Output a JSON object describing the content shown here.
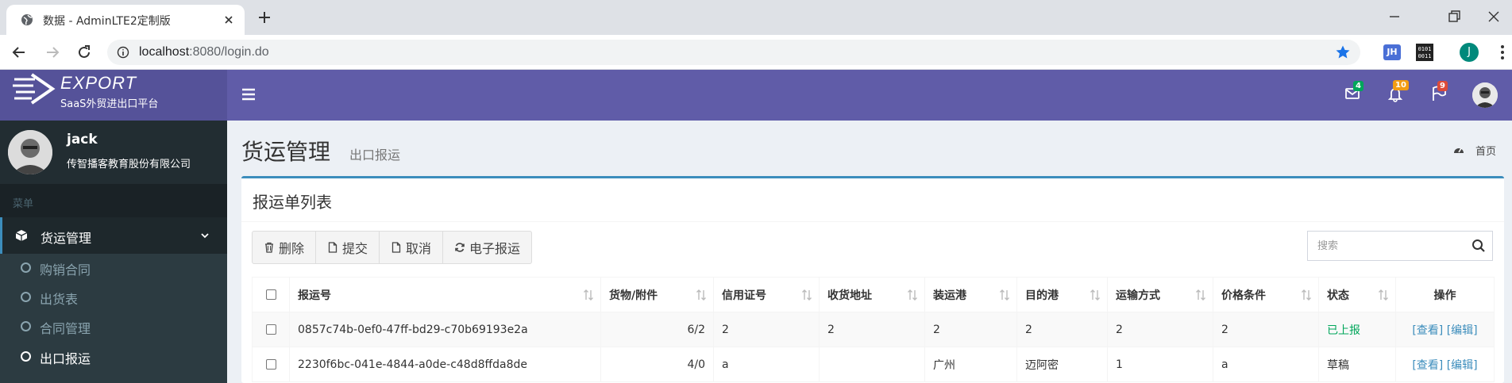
{
  "browser": {
    "tab_title": "数据 - AdminLTE2定制版",
    "url_host": "localhost",
    "url_rest": ":8080/login.do",
    "profile_initial": "J",
    "ext_jh": "JH"
  },
  "app": {
    "logo_text": "EXPORT",
    "logo_subtitle": "SaaS外贸进出口平台",
    "notifications": {
      "messages": "4",
      "alerts": "10",
      "tasks": "9"
    },
    "colors": {
      "navbar": "#605ca8",
      "logo": "#555299",
      "sidebar": "#222d32",
      "accent": "#3c8dbc"
    }
  },
  "sidebar": {
    "user_name": "jack",
    "user_company": "传智播客教育股份有限公司",
    "menu_header": "菜单",
    "menu_item": "货运管理",
    "submenu": [
      "购销合同",
      "出货表",
      "合同管理",
      "出口报运"
    ]
  },
  "content": {
    "title": "货运管理",
    "subtitle": "出口报运",
    "breadcrumb": "首页",
    "box_title": "报运单列表",
    "buttons": {
      "delete": "删除",
      "submit": "提交",
      "cancel": "取消",
      "e_report": "电子报运"
    },
    "search_placeholder": "搜索",
    "table": {
      "headers": [
        "报运号",
        "货物/附件",
        "信用证号",
        "收货地址",
        "装运港",
        "目的港",
        "运输方式",
        "价格条件",
        "状态",
        "操作"
      ],
      "rows": [
        {
          "id": "0857c74b-0ef0-47ff-bd29-c70b69193e2a",
          "goods": "6/2",
          "lc": "2",
          "address": "2",
          "port_from": "2",
          "port_to": "2",
          "transport": "2",
          "price": "2",
          "status": "已上报",
          "view": "[查看]",
          "edit": "[编辑]"
        },
        {
          "id": "2230f6bc-041e-4844-a0de-c48d8ffda8de",
          "goods": "4/0",
          "lc": "a",
          "address": "",
          "port_from": "广州",
          "port_to": "迈阿密",
          "transport": "1",
          "price": "a",
          "status": "草稿",
          "view": "[查看]",
          "edit": "[编辑]"
        }
      ]
    }
  }
}
